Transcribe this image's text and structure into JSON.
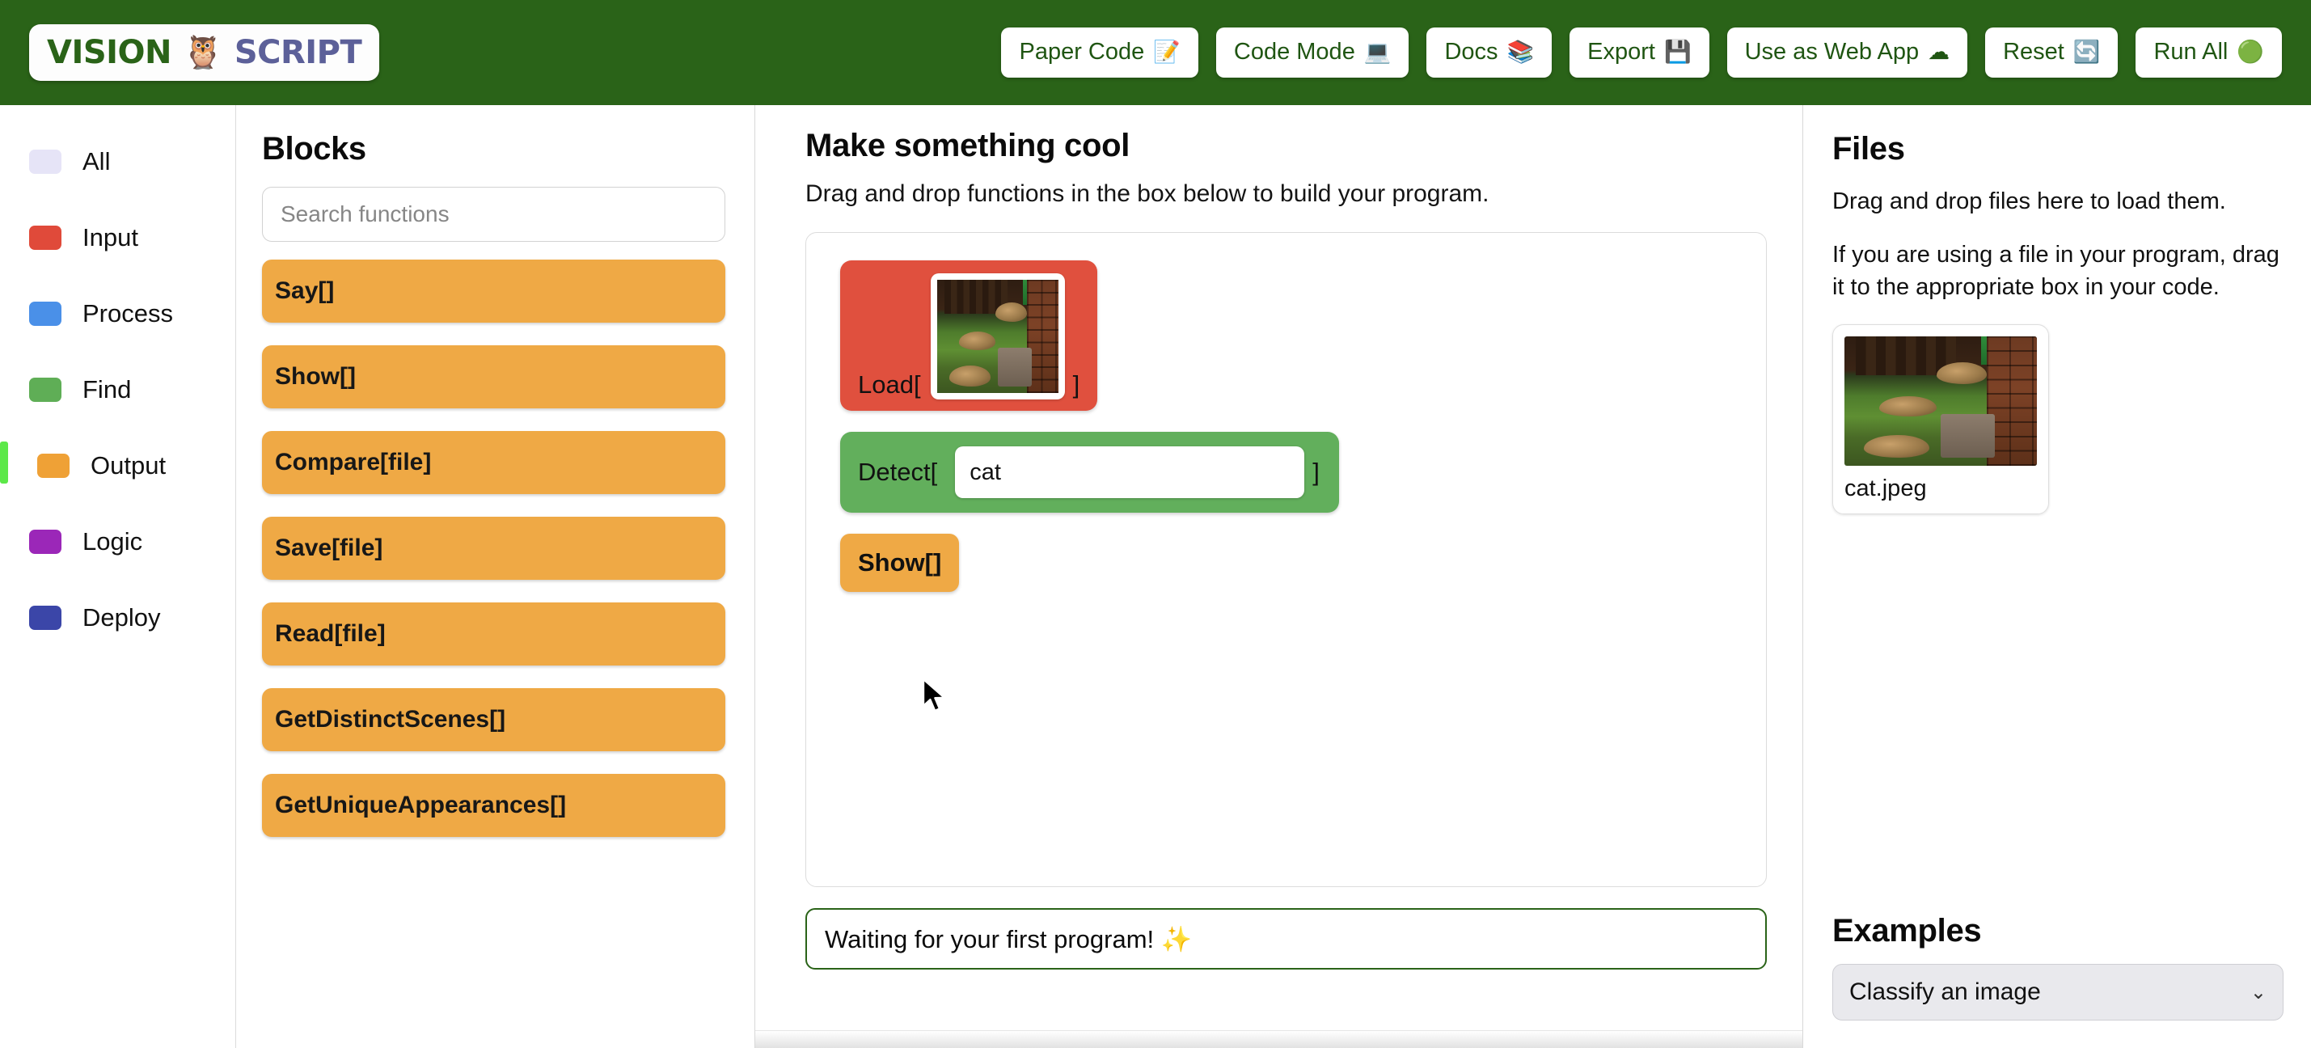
{
  "header": {
    "logo": {
      "word1": "VISION",
      "owl": "🦉",
      "word2": "SCRIPT"
    },
    "buttons": [
      {
        "label": "Paper Code",
        "icon": "📝",
        "icon_name": "memo-icon"
      },
      {
        "label": "Code Mode",
        "icon": "💻",
        "icon_name": "laptop-icon"
      },
      {
        "label": "Docs",
        "icon": "📚",
        "icon_name": "books-icon"
      },
      {
        "label": "Export",
        "icon": "💾",
        "icon_name": "floppy-disk-icon"
      },
      {
        "label": "Use as Web App",
        "icon": "☁",
        "icon_name": "cloud-icon"
      },
      {
        "label": "Reset",
        "icon": "🔄",
        "icon_name": "refresh-icon"
      },
      {
        "label": "Run All",
        "icon": "🟢",
        "icon_name": "green-circle-icon"
      }
    ]
  },
  "sidebar": {
    "items": [
      {
        "label": "All",
        "color": "#E6E4F7",
        "active": false
      },
      {
        "label": "Input",
        "color": "#E04A3A",
        "active": false
      },
      {
        "label": "Process",
        "color": "#4A90E8",
        "active": false
      },
      {
        "label": "Find",
        "color": "#5FAE56",
        "active": false
      },
      {
        "label": "Output",
        "color": "#EFA136",
        "active": true
      },
      {
        "label": "Logic",
        "color": "#9B27B8",
        "active": false
      },
      {
        "label": "Deploy",
        "color": "#3B46A8",
        "active": false
      }
    ],
    "active_indicator_color": "#5CE849"
  },
  "blocks": {
    "title": "Blocks",
    "search_placeholder": "Search functions",
    "search_value": "",
    "chip_color": "#EFA945",
    "items": [
      {
        "label": "Say[]"
      },
      {
        "label": "Show[]"
      },
      {
        "label": "Compare[file]"
      },
      {
        "label": "Save[file]"
      },
      {
        "label": "Read[file]"
      },
      {
        "label": "GetDistinctScenes[]"
      },
      {
        "label": "GetUniqueAppearances[]"
      }
    ]
  },
  "center": {
    "title": "Make something cool",
    "subtitle": "Drag and drop functions in the box below to build your program.",
    "program": [
      {
        "fn": "Load[",
        "close": "]",
        "slot_type": "image",
        "slot_value": "cat.jpeg",
        "color": "#E0503E",
        "kind": "load-block"
      },
      {
        "fn": "Detect[",
        "close": "]",
        "slot_type": "text",
        "slot_value": "cat",
        "color": "#62AF5C",
        "kind": "detect-block"
      },
      {
        "fn": "Show[]",
        "close": "",
        "slot_type": "none",
        "slot_value": "",
        "color": "#EFA945",
        "kind": "show-block"
      }
    ],
    "status": "Waiting for your first program! ✨",
    "status_border_color": "#2A6318"
  },
  "files": {
    "title": "Files",
    "paragraph_1": "Drag and drop files here to load them.",
    "paragraph_2": "If you are using a file in your program, drag it to the appropriate box in your code.",
    "file": {
      "name": "cat.jpeg"
    }
  },
  "examples": {
    "title": "Examples",
    "selected": "Classify an image",
    "chevron": "⌄"
  },
  "theme": {
    "header_green": "#2A6318",
    "accent_green": "#5CE849",
    "orange": "#EFA945",
    "red": "#E0503E",
    "green": "#62AF5C"
  }
}
